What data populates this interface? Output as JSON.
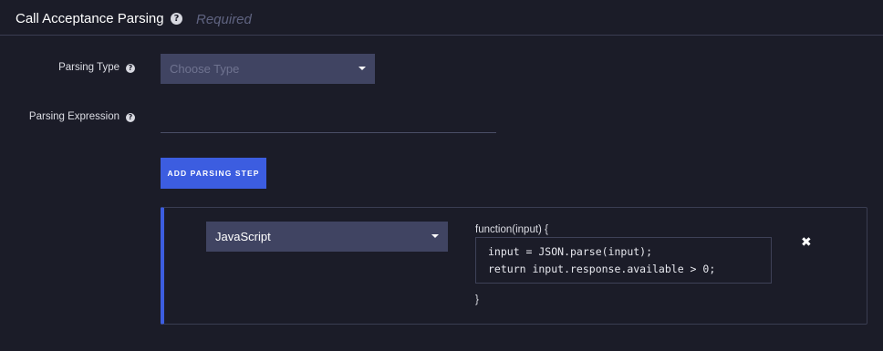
{
  "header": {
    "title": "Call Acceptance Parsing",
    "help_icon": "?",
    "required_label": "Required"
  },
  "fields": {
    "parsing_type": {
      "label": "Parsing Type",
      "help_icon": "?",
      "selected": "",
      "placeholder": "Choose Type"
    },
    "parsing_expression": {
      "label": "Parsing Expression",
      "help_icon": "?",
      "value": "",
      "placeholder": ""
    }
  },
  "add_step_button": {
    "label": "ADD PARSING STEP"
  },
  "parsing_step": {
    "language": "JavaScript",
    "function_header": "function(input) {",
    "code_lines": [
      "input = JSON.parse(input);",
      "return input.response.available > 0;"
    ],
    "function_footer": "}",
    "remove_icon": "✖"
  },
  "colors": {
    "background": "#1b1c28",
    "accent_blue": "#3c5de0",
    "select_bg": "#404462",
    "border": "#3a3d52",
    "muted_text": "#5f6380"
  }
}
